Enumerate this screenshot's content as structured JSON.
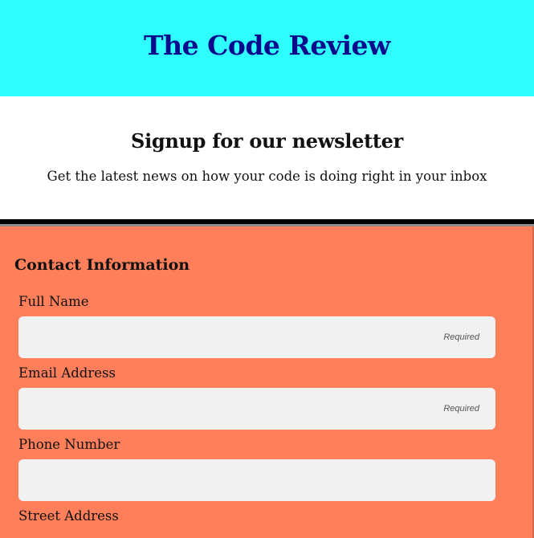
{
  "header": {
    "title": "The Code Review"
  },
  "signup": {
    "title": "Signup for our newsletter",
    "subtitle": "Get the latest news on how your code is doing right in your inbox"
  },
  "form": {
    "section_title": "Contact Information",
    "fields": [
      {
        "label": "Full Name",
        "value": "",
        "hint": "Required"
      },
      {
        "label": "Email Address",
        "value": "",
        "hint": "Required"
      },
      {
        "label": "Phone Number",
        "value": "",
        "hint": ""
      },
      {
        "label": "Street Address"
      }
    ]
  },
  "colors": {
    "header_bg": "#2efcff",
    "title_color": "#0a0a8c",
    "form_bg": "#ff7f5a",
    "input_bg": "#f1f1f1"
  }
}
